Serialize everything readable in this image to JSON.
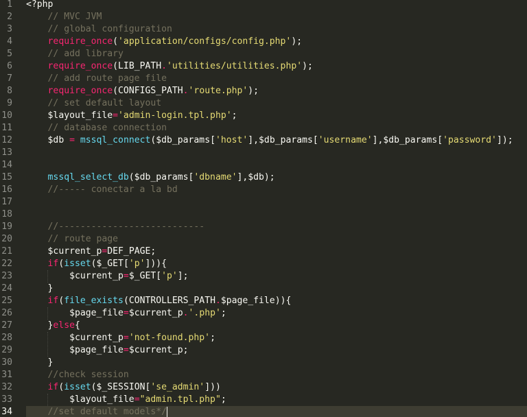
{
  "theme": {
    "background": "#272822",
    "active_line": "#3e3d32",
    "gutter_text": "#8f908a",
    "text": "#f8f8f2",
    "comment": "#75715e",
    "keyword": "#f92672",
    "string": "#e6db74",
    "function": "#66d9ef",
    "constant": "#ae81ff"
  },
  "editor": {
    "active_line_number": 34,
    "lines": [
      {
        "n": "1",
        "tokens": [
          {
            "t": "<?php",
            "c": "tag"
          }
        ]
      },
      {
        "n": "2",
        "tokens": [
          {
            "t": "    "
          },
          {
            "t": "// MVC JVM",
            "c": "comment"
          }
        ]
      },
      {
        "n": "3",
        "tokens": [
          {
            "t": "    "
          },
          {
            "t": "// global configuration",
            "c": "comment"
          }
        ]
      },
      {
        "n": "4",
        "tokens": [
          {
            "t": "    "
          },
          {
            "t": "require_once",
            "c": "keyword"
          },
          {
            "t": "("
          },
          {
            "t": "'application/configs/config.php'",
            "c": "string"
          },
          {
            "t": ");"
          }
        ]
      },
      {
        "n": "5",
        "tokens": [
          {
            "t": "    "
          },
          {
            "t": "// add library",
            "c": "comment"
          }
        ]
      },
      {
        "n": "6",
        "tokens": [
          {
            "t": "    "
          },
          {
            "t": "require_once",
            "c": "keyword"
          },
          {
            "t": "("
          },
          {
            "t": "LIB_PATH",
            "c": "constant"
          },
          {
            "t": ".",
            "c": "keyword"
          },
          {
            "t": "'utilities/utilities.php'",
            "c": "string"
          },
          {
            "t": ");"
          }
        ]
      },
      {
        "n": "7",
        "tokens": [
          {
            "t": "    "
          },
          {
            "t": "// add route page file",
            "c": "comment"
          }
        ]
      },
      {
        "n": "8",
        "tokens": [
          {
            "t": "    "
          },
          {
            "t": "require_once",
            "c": "keyword"
          },
          {
            "t": "("
          },
          {
            "t": "CONFIGS_PATH",
            "c": "constant"
          },
          {
            "t": ".",
            "c": "keyword"
          },
          {
            "t": "'route.php'",
            "c": "string"
          },
          {
            "t": ");"
          }
        ]
      },
      {
        "n": "9",
        "tokens": [
          {
            "t": "    "
          },
          {
            "t": "// set default layout",
            "c": "comment"
          }
        ]
      },
      {
        "n": "10",
        "tokens": [
          {
            "t": "    "
          },
          {
            "t": "$layout_file"
          },
          {
            "t": "=",
            "c": "keyword"
          },
          {
            "t": "'admin-login.tpl.php'",
            "c": "string"
          },
          {
            "t": ";"
          }
        ]
      },
      {
        "n": "11",
        "tokens": [
          {
            "t": "    "
          },
          {
            "t": "// database connection",
            "c": "comment"
          }
        ]
      },
      {
        "n": "12",
        "tokens": [
          {
            "t": "    "
          },
          {
            "t": "$db "
          },
          {
            "t": "=",
            "c": "keyword"
          },
          {
            "t": " "
          },
          {
            "t": "mssql_connect",
            "c": "func"
          },
          {
            "t": "($db_params["
          },
          {
            "t": "'host'",
            "c": "string"
          },
          {
            "t": "],$db_params["
          },
          {
            "t": "'username'",
            "c": "string"
          },
          {
            "t": "],$db_params["
          },
          {
            "t": "'password'",
            "c": "string"
          },
          {
            "t": "]);"
          }
        ]
      },
      {
        "n": "13",
        "tokens": []
      },
      {
        "n": "14",
        "tokens": []
      },
      {
        "n": "15",
        "tokens": [
          {
            "t": "    "
          },
          {
            "t": "mssql_select_db",
            "c": "func"
          },
          {
            "t": "($db_params["
          },
          {
            "t": "'dbname'",
            "c": "string"
          },
          {
            "t": "],$db);"
          }
        ]
      },
      {
        "n": "16",
        "tokens": [
          {
            "t": "    "
          },
          {
            "t": "//----- conectar a la bd",
            "c": "comment"
          }
        ]
      },
      {
        "n": "17",
        "tokens": []
      },
      {
        "n": "18",
        "tokens": []
      },
      {
        "n": "19",
        "tokens": [
          {
            "t": "    "
          },
          {
            "t": "//---------------------------",
            "c": "comment"
          }
        ]
      },
      {
        "n": "20",
        "tokens": [
          {
            "t": "    "
          },
          {
            "t": "// route page",
            "c": "comment"
          }
        ]
      },
      {
        "n": "21",
        "tokens": [
          {
            "t": "    "
          },
          {
            "t": "$current_p"
          },
          {
            "t": "=",
            "c": "keyword"
          },
          {
            "t": "DEF_PAGE",
            "c": "constant"
          },
          {
            "t": ";"
          }
        ]
      },
      {
        "n": "22",
        "tokens": [
          {
            "t": "    "
          },
          {
            "t": "if",
            "c": "keyword"
          },
          {
            "t": "("
          },
          {
            "t": "isset",
            "c": "func"
          },
          {
            "t": "($_GET["
          },
          {
            "t": "'p'",
            "c": "string"
          },
          {
            "t": "])){"
          }
        ]
      },
      {
        "n": "23",
        "tokens": [
          {
            "t": "        "
          },
          {
            "t": "$current_p"
          },
          {
            "t": "=",
            "c": "keyword"
          },
          {
            "t": "$_GET["
          },
          {
            "t": "'p'",
            "c": "string"
          },
          {
            "t": "];"
          }
        ]
      },
      {
        "n": "24",
        "tokens": [
          {
            "t": "    }"
          }
        ]
      },
      {
        "n": "25",
        "tokens": [
          {
            "t": "    "
          },
          {
            "t": "if",
            "c": "keyword"
          },
          {
            "t": "("
          },
          {
            "t": "file_exists",
            "c": "func"
          },
          {
            "t": "("
          },
          {
            "t": "CONTROLLERS_PATH",
            "c": "constant"
          },
          {
            "t": ".",
            "c": "keyword"
          },
          {
            "t": "$page_file)){"
          }
        ]
      },
      {
        "n": "26",
        "tokens": [
          {
            "t": "        "
          },
          {
            "t": "$page_file"
          },
          {
            "t": "=",
            "c": "keyword"
          },
          {
            "t": "$current_p"
          },
          {
            "t": ".",
            "c": "keyword"
          },
          {
            "t": "'.php'",
            "c": "string"
          },
          {
            "t": ";"
          }
        ]
      },
      {
        "n": "27",
        "tokens": [
          {
            "t": "    }"
          },
          {
            "t": "else",
            "c": "keyword"
          },
          {
            "t": "{"
          }
        ]
      },
      {
        "n": "28",
        "tokens": [
          {
            "t": "        "
          },
          {
            "t": "$current_p"
          },
          {
            "t": "=",
            "c": "keyword"
          },
          {
            "t": "'not-found.php'",
            "c": "string"
          },
          {
            "t": ";"
          }
        ]
      },
      {
        "n": "29",
        "tokens": [
          {
            "t": "        "
          },
          {
            "t": "$page_file"
          },
          {
            "t": "=",
            "c": "keyword"
          },
          {
            "t": "$current_p;"
          }
        ]
      },
      {
        "n": "30",
        "tokens": [
          {
            "t": "    }"
          }
        ]
      },
      {
        "n": "31",
        "tokens": [
          {
            "t": "    "
          },
          {
            "t": "//check session",
            "c": "comment"
          }
        ]
      },
      {
        "n": "32",
        "tokens": [
          {
            "t": "    "
          },
          {
            "t": "if",
            "c": "keyword"
          },
          {
            "t": "("
          },
          {
            "t": "isset",
            "c": "func"
          },
          {
            "t": "($_SESSION["
          },
          {
            "t": "'se_admin'",
            "c": "string"
          },
          {
            "t": "]))"
          }
        ]
      },
      {
        "n": "33",
        "tokens": [
          {
            "t": "        "
          },
          {
            "t": "$layout_file"
          },
          {
            "t": "=",
            "c": "keyword"
          },
          {
            "t": "\"admin.tpl.php\"",
            "c": "string"
          },
          {
            "t": ";"
          }
        ]
      },
      {
        "n": "34",
        "tokens": [
          {
            "t": "    "
          },
          {
            "t": "//set default models*/",
            "c": "comment"
          }
        ]
      }
    ]
  }
}
